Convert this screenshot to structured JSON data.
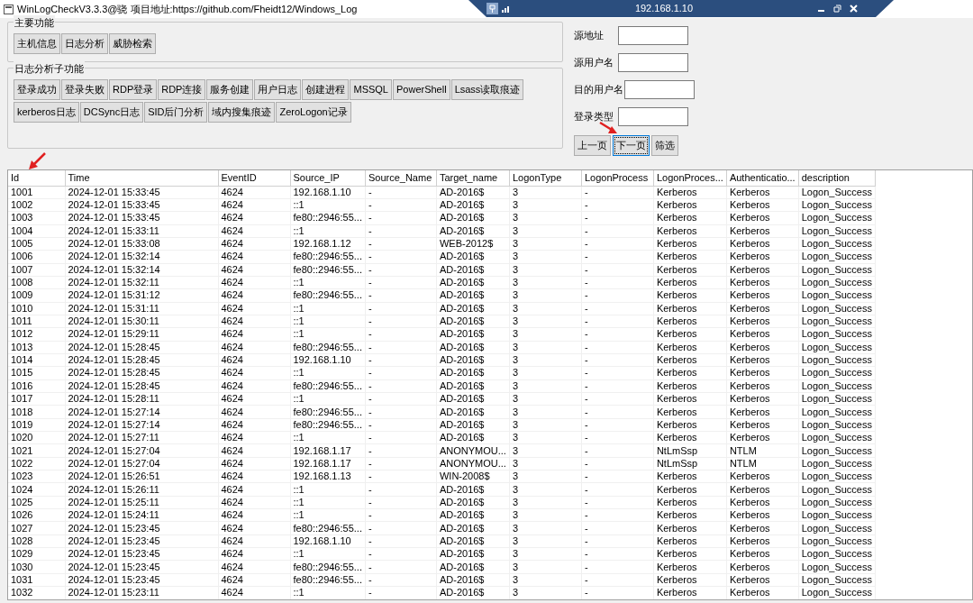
{
  "window": {
    "title": "WinLogCheckV3.3.3@骁 项目地址:https://github.com/Fheidt12/Windows_Log"
  },
  "remote_bar": {
    "host": "192.168.1.10"
  },
  "main_group": {
    "title": "主要功能",
    "buttons": [
      "主机信息",
      "日志分析",
      "威胁检索"
    ]
  },
  "sub_group": {
    "title": "日志分析子功能",
    "buttons": [
      "登录成功",
      "登录失败",
      "RDP登录",
      "RDP连接",
      "服务创建",
      "用户日志",
      "创建进程",
      "MSSQL",
      "PowerShell",
      "Lsass读取痕迹",
      "kerberos日志",
      "DCSync日志",
      "SID后门分析",
      "域内搜集痕迹",
      "ZeroLogon记录"
    ]
  },
  "filters": [
    {
      "label": "源地址"
    },
    {
      "label": "源用户名"
    },
    {
      "label": "目的用户名"
    },
    {
      "label": "登录类型"
    }
  ],
  "pager": [
    {
      "label": "上一页",
      "focused": false
    },
    {
      "label": "下一页",
      "focused": true
    },
    {
      "label": "筛选",
      "focused": false
    }
  ],
  "table": {
    "columns": [
      "Id",
      "Time",
      "EventID",
      "Source_IP",
      "Source_Name",
      "Target_name",
      "LogonType",
      "LogonProcess",
      "LogonProces...",
      "Authenticatio...",
      "description"
    ],
    "rows": [
      [
        "1001",
        "2024-12-01 15:33:45",
        "4624",
        "192.168.1.10",
        "-",
        "AD-2016$",
        "3",
        "-",
        "Kerberos",
        "Kerberos",
        "Logon_Success"
      ],
      [
        "1002",
        "2024-12-01 15:33:45",
        "4624",
        "::1",
        "-",
        "AD-2016$",
        "3",
        "-",
        "Kerberos",
        "Kerberos",
        "Logon_Success"
      ],
      [
        "1003",
        "2024-12-01 15:33:45",
        "4624",
        "fe80::2946:55...",
        "-",
        "AD-2016$",
        "3",
        "-",
        "Kerberos",
        "Kerberos",
        "Logon_Success"
      ],
      [
        "1004",
        "2024-12-01 15:33:11",
        "4624",
        "::1",
        "-",
        "AD-2016$",
        "3",
        "-",
        "Kerberos",
        "Kerberos",
        "Logon_Success"
      ],
      [
        "1005",
        "2024-12-01 15:33:08",
        "4624",
        "192.168.1.12",
        "-",
        "WEB-2012$",
        "3",
        "-",
        "Kerberos",
        "Kerberos",
        "Logon_Success"
      ],
      [
        "1006",
        "2024-12-01 15:32:14",
        "4624",
        "fe80::2946:55...",
        "-",
        "AD-2016$",
        "3",
        "-",
        "Kerberos",
        "Kerberos",
        "Logon_Success"
      ],
      [
        "1007",
        "2024-12-01 15:32:14",
        "4624",
        "fe80::2946:55...",
        "-",
        "AD-2016$",
        "3",
        "-",
        "Kerberos",
        "Kerberos",
        "Logon_Success"
      ],
      [
        "1008",
        "2024-12-01 15:32:11",
        "4624",
        "::1",
        "-",
        "AD-2016$",
        "3",
        "-",
        "Kerberos",
        "Kerberos",
        "Logon_Success"
      ],
      [
        "1009",
        "2024-12-01 15:31:12",
        "4624",
        "fe80::2946:55...",
        "-",
        "AD-2016$",
        "3",
        "-",
        "Kerberos",
        "Kerberos",
        "Logon_Success"
      ],
      [
        "1010",
        "2024-12-01 15:31:11",
        "4624",
        "::1",
        "-",
        "AD-2016$",
        "3",
        "-",
        "Kerberos",
        "Kerberos",
        "Logon_Success"
      ],
      [
        "1011",
        "2024-12-01 15:30:11",
        "4624",
        "::1",
        "-",
        "AD-2016$",
        "3",
        "-",
        "Kerberos",
        "Kerberos",
        "Logon_Success"
      ],
      [
        "1012",
        "2024-12-01 15:29:11",
        "4624",
        "::1",
        "-",
        "AD-2016$",
        "3",
        "-",
        "Kerberos",
        "Kerberos",
        "Logon_Success"
      ],
      [
        "1013",
        "2024-12-01 15:28:45",
        "4624",
        "fe80::2946:55...",
        "-",
        "AD-2016$",
        "3",
        "-",
        "Kerberos",
        "Kerberos",
        "Logon_Success"
      ],
      [
        "1014",
        "2024-12-01 15:28:45",
        "4624",
        "192.168.1.10",
        "-",
        "AD-2016$",
        "3",
        "-",
        "Kerberos",
        "Kerberos",
        "Logon_Success"
      ],
      [
        "1015",
        "2024-12-01 15:28:45",
        "4624",
        "::1",
        "-",
        "AD-2016$",
        "3",
        "-",
        "Kerberos",
        "Kerberos",
        "Logon_Success"
      ],
      [
        "1016",
        "2024-12-01 15:28:45",
        "4624",
        "fe80::2946:55...",
        "-",
        "AD-2016$",
        "3",
        "-",
        "Kerberos",
        "Kerberos",
        "Logon_Success"
      ],
      [
        "1017",
        "2024-12-01 15:28:11",
        "4624",
        "::1",
        "-",
        "AD-2016$",
        "3",
        "-",
        "Kerberos",
        "Kerberos",
        "Logon_Success"
      ],
      [
        "1018",
        "2024-12-01 15:27:14",
        "4624",
        "fe80::2946:55...",
        "-",
        "AD-2016$",
        "3",
        "-",
        "Kerberos",
        "Kerberos",
        "Logon_Success"
      ],
      [
        "1019",
        "2024-12-01 15:27:14",
        "4624",
        "fe80::2946:55...",
        "-",
        "AD-2016$",
        "3",
        "-",
        "Kerberos",
        "Kerberos",
        "Logon_Success"
      ],
      [
        "1020",
        "2024-12-01 15:27:11",
        "4624",
        "::1",
        "-",
        "AD-2016$",
        "3",
        "-",
        "Kerberos",
        "Kerberos",
        "Logon_Success"
      ],
      [
        "1021",
        "2024-12-01 15:27:04",
        "4624",
        "192.168.1.17",
        "-",
        "ANONYMOU...",
        "3",
        "-",
        "NtLmSsp",
        "NTLM",
        "Logon_Success"
      ],
      [
        "1022",
        "2024-12-01 15:27:04",
        "4624",
        "192.168.1.17",
        "-",
        "ANONYMOU...",
        "3",
        "-",
        "NtLmSsp",
        "NTLM",
        "Logon_Success"
      ],
      [
        "1023",
        "2024-12-01 15:26:51",
        "4624",
        "192.168.1.13",
        "-",
        "WIN-2008$",
        "3",
        "-",
        "Kerberos",
        "Kerberos",
        "Logon_Success"
      ],
      [
        "1024",
        "2024-12-01 15:26:11",
        "4624",
        "::1",
        "-",
        "AD-2016$",
        "3",
        "-",
        "Kerberos",
        "Kerberos",
        "Logon_Success"
      ],
      [
        "1025",
        "2024-12-01 15:25:11",
        "4624",
        "::1",
        "-",
        "AD-2016$",
        "3",
        "-",
        "Kerberos",
        "Kerberos",
        "Logon_Success"
      ],
      [
        "1026",
        "2024-12-01 15:24:11",
        "4624",
        "::1",
        "-",
        "AD-2016$",
        "3",
        "-",
        "Kerberos",
        "Kerberos",
        "Logon_Success"
      ],
      [
        "1027",
        "2024-12-01 15:23:45",
        "4624",
        "fe80::2946:55...",
        "-",
        "AD-2016$",
        "3",
        "-",
        "Kerberos",
        "Kerberos",
        "Logon_Success"
      ],
      [
        "1028",
        "2024-12-01 15:23:45",
        "4624",
        "192.168.1.10",
        "-",
        "AD-2016$",
        "3",
        "-",
        "Kerberos",
        "Kerberos",
        "Logon_Success"
      ],
      [
        "1029",
        "2024-12-01 15:23:45",
        "4624",
        "::1",
        "-",
        "AD-2016$",
        "3",
        "-",
        "Kerberos",
        "Kerberos",
        "Logon_Success"
      ],
      [
        "1030",
        "2024-12-01 15:23:45",
        "4624",
        "fe80::2946:55...",
        "-",
        "AD-2016$",
        "3",
        "-",
        "Kerberos",
        "Kerberos",
        "Logon_Success"
      ],
      [
        "1031",
        "2024-12-01 15:23:45",
        "4624",
        "fe80::2946:55...",
        "-",
        "AD-2016$",
        "3",
        "-",
        "Kerberos",
        "Kerberos",
        "Logon_Success"
      ],
      [
        "1032",
        "2024-12-01 15:23:11",
        "4624",
        "::1",
        "-",
        "AD-2016$",
        "3",
        "-",
        "Kerberos",
        "Kerberos",
        "Logon_Success"
      ]
    ]
  }
}
